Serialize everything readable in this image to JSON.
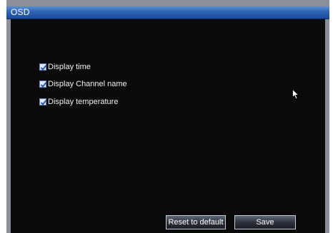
{
  "window": {
    "title": "OSD"
  },
  "options": [
    {
      "label": "Display time",
      "checked": true
    },
    {
      "label": "Display Channel name",
      "checked": true
    },
    {
      "label": "Display temperature",
      "checked": true
    }
  ],
  "buttons": {
    "reset_label": "Reset to default",
    "save_label": "Save"
  },
  "colors": {
    "titlebar": "#2f63b4",
    "panel_background": "#0a0a0a",
    "checkbox_check": "#1f4fa8"
  },
  "icons": {
    "cursor": "mouse-pointer-icon",
    "check": "checkmark-icon"
  }
}
